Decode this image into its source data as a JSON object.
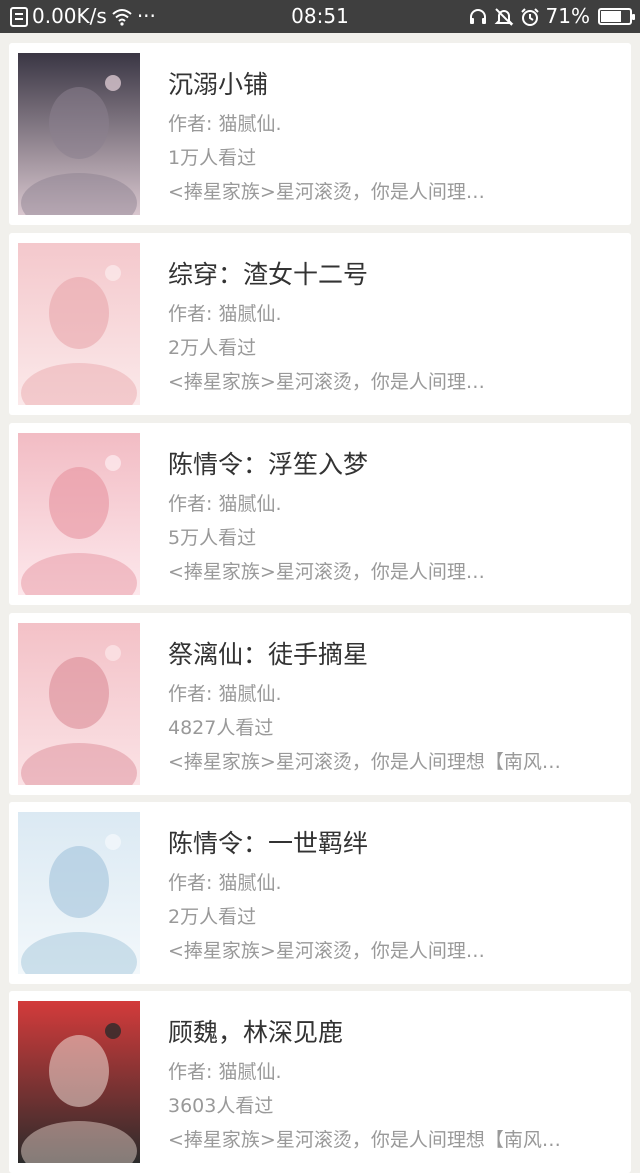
{
  "status_bar": {
    "speed": "0.00K/s",
    "more": "···",
    "time": "08:51",
    "battery_percent": "71%",
    "battery_level": 0.71
  },
  "books": [
    {
      "title": "沉溺小铺",
      "author": "作者: 猫腻仙.",
      "views": "1万人看过",
      "desc": "<捧星家族>星河滚烫，你是人间理…",
      "colors": [
        "#3a3644",
        "#8a7f8e",
        "#d9c7cf"
      ]
    },
    {
      "title": "综穿：渣女十二号",
      "author": "作者: 猫腻仙.",
      "views": "2万人看过",
      "desc": "<捧星家族>星河滚烫，你是人间理…",
      "colors": [
        "#f4c8cc",
        "#e8a3a8",
        "#fbe9ea"
      ]
    },
    {
      "title": "陈情令：浮笙入梦",
      "author": "作者: 猫腻仙.",
      "views": "5万人看过",
      "desc": "<捧星家族>星河滚烫，你是人间理…",
      "colors": [
        "#f2bcc4",
        "#e58e9b",
        "#fde8ec"
      ]
    },
    {
      "title": "祭漓仙：徒手摘星",
      "author": "作者: 猫腻仙.",
      "views": "4827人看过",
      "desc": "<捧星家族>星河滚烫，你是人间理想【南风…",
      "colors": [
        "#f3c1c7",
        "#d98692",
        "#fbe3e6"
      ]
    },
    {
      "title": "陈情令：一世羁绊",
      "author": "作者: 猫腻仙.",
      "views": "2万人看过",
      "desc": "<捧星家族>星河滚烫，你是人间理…",
      "colors": [
        "#dbe9f3",
        "#9cc0d8",
        "#f3f8fb"
      ]
    },
    {
      "title": "顾魏，林深见鹿",
      "author": "作者: 猫腻仙.",
      "views": "3603人看过",
      "desc": "<捧星家族>星河滚烫，你是人间理想【南风…",
      "colors": [
        "#d33b3b",
        "#f1dfd7",
        "#2b2b2b"
      ]
    }
  ]
}
